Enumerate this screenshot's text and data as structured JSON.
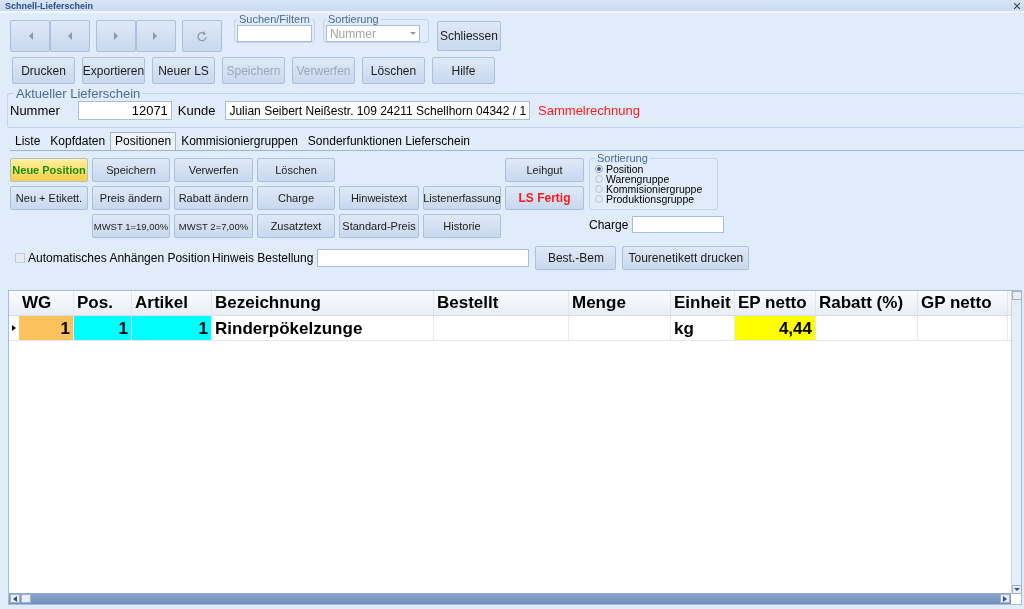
{
  "window": {
    "title": "Schnell-Lieferschein"
  },
  "navigation": [
    {
      "kind": "first"
    },
    {
      "kind": "prev"
    },
    {
      "kind": "next"
    },
    {
      "kind": "last"
    },
    {
      "kind": "refresh"
    }
  ],
  "search": {
    "label": "Suchen/Filtern"
  },
  "sort": {
    "label": "Sortierung",
    "value": "Nummer",
    "disabled": true
  },
  "close_button": {
    "label": "Schliessen"
  },
  "toolbar": [
    {
      "label": "Drucken",
      "disabled": false
    },
    {
      "label": "Exportieren",
      "disabled": false
    },
    {
      "label": "Neuer LS",
      "disabled": false
    },
    {
      "label": "Speichern",
      "disabled": true
    },
    {
      "label": "Verwerfen",
      "disabled": true
    },
    {
      "label": "Löschen",
      "disabled": false
    },
    {
      "label": "Hilfe",
      "disabled": false
    }
  ],
  "current": {
    "legend": "Aktueller Lieferschein",
    "number_label": "Nummer",
    "number": "12071",
    "customer_label": "Kunde",
    "customer": "Julian Seibert Neißestr. 109 24211 Schellhorn 04342 / 1",
    "note": "Sammelrechnung"
  },
  "tabs": [
    {
      "label": "Liste",
      "selected": false
    },
    {
      "label": "Kopfdaten",
      "selected": false
    },
    {
      "label": "Positionen",
      "selected": true
    },
    {
      "label": "Kommisioniergruppen",
      "selected": false
    },
    {
      "label": "Sonderfunktionen Lieferschein",
      "selected": false
    }
  ],
  "position_buttons": [
    {
      "label": "Neue Position",
      "kind": "highlight"
    },
    {
      "label": "Speichern",
      "kind": "normal"
    },
    {
      "label": "Verwerfen",
      "kind": "normal"
    },
    {
      "label": "Löschen",
      "kind": "normal"
    },
    {
      "label": "Leihgut",
      "kind": "normal"
    },
    {
      "label": "Neu + Etikett.",
      "kind": "normal"
    },
    {
      "label": "Preis ändern",
      "kind": "normal"
    },
    {
      "label": "Rabatt ändern",
      "kind": "normal"
    },
    {
      "label": "Charge",
      "kind": "normal"
    },
    {
      "label": "Hinweistext",
      "kind": "normal"
    },
    {
      "label": "Listenerfassung",
      "kind": "normal"
    },
    {
      "label": "LS Fertig",
      "kind": "alert"
    },
    {
      "label": "MWST 1=19,00%",
      "kind": "small"
    },
    {
      "label": "MWST 2=7,00%",
      "kind": "small"
    },
    {
      "label": "Zusatztext",
      "kind": "normal"
    },
    {
      "label": "Standard-Preis",
      "kind": "normal"
    },
    {
      "label": "Historie",
      "kind": "normal"
    }
  ],
  "sort_options": {
    "legend": "Sortierung",
    "options": [
      {
        "label": "Position",
        "selected": true
      },
      {
        "label": "Warengruppe",
        "selected": false
      },
      {
        "label": "Kommisioniergruppe",
        "selected": false
      },
      {
        "label": "Produktionsgruppe",
        "selected": false
      }
    ]
  },
  "charge": {
    "label": "Charge"
  },
  "auto_append": {
    "label": "Automatisches Anhängen Position",
    "checked": false
  },
  "order_note": {
    "label": "Hinweis Bestellung"
  },
  "bottom_buttons": [
    {
      "label": "Best.-Bem"
    },
    {
      "label": "Tourenetikett drucken"
    }
  ],
  "table": {
    "columns": [
      {
        "label": "WG"
      },
      {
        "label": "Pos."
      },
      {
        "label": "Artikel"
      },
      {
        "label": "Bezeichnung"
      },
      {
        "label": "Bestellt"
      },
      {
        "label": "Menge"
      },
      {
        "label": "Einheit"
      },
      {
        "label": "EP netto"
      },
      {
        "label": "Rabatt (%)"
      },
      {
        "label": "GP netto"
      }
    ],
    "rows": [
      {
        "selected": true,
        "cells": [
          {
            "text": "1",
            "color": "#fbc25e"
          },
          {
            "text": "1",
            "color": "#00ffff"
          },
          {
            "text": "1",
            "color": "#00ffff"
          },
          {
            "text": "Rinderpökelzunge"
          },
          {},
          {},
          {
            "text": "kg"
          },
          {
            "text": "4,44",
            "color": "#ffff00"
          },
          {},
          {}
        ]
      }
    ]
  }
}
